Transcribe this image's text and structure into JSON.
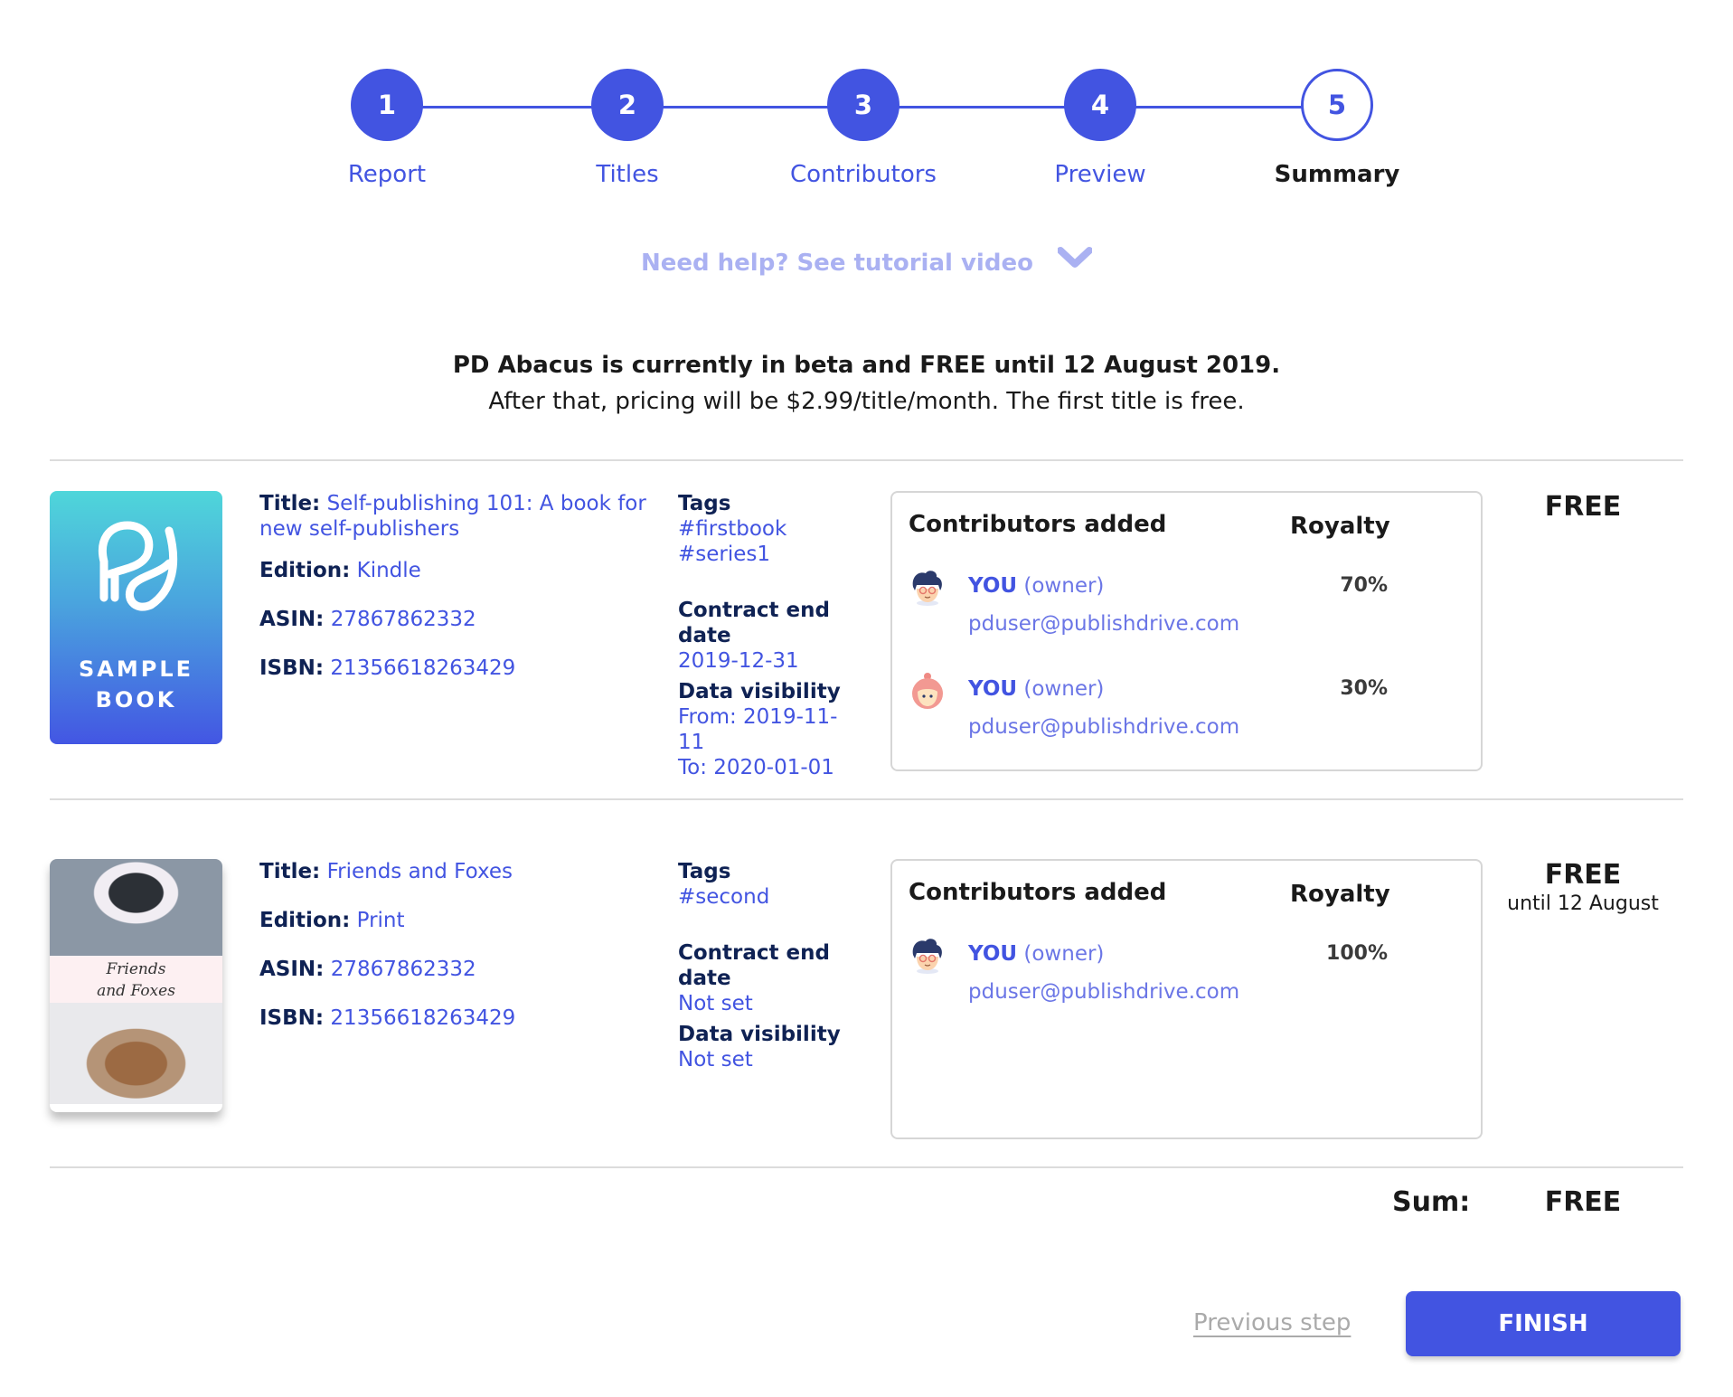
{
  "stepper": {
    "steps": [
      {
        "number": "1",
        "label": "Report",
        "state": "completed"
      },
      {
        "number": "2",
        "label": "Titles",
        "state": "completed"
      },
      {
        "number": "3",
        "label": "Contributors",
        "state": "completed"
      },
      {
        "number": "4",
        "label": "Preview",
        "state": "completed"
      },
      {
        "number": "5",
        "label": "Summary",
        "state": "current"
      }
    ]
  },
  "help": {
    "label": "Need help? See tutorial video",
    "icon": "chevron-down-icon"
  },
  "notice": {
    "line1": "PD Abacus is currently in beta and FREE until 12 August 2019.",
    "line2": "After that, pricing will be $2.99/title/month. The first title is free."
  },
  "labels": {
    "title": "Title:",
    "edition": "Edition:",
    "asin": "ASIN:",
    "isbn": "ISBN:",
    "tags": "Tags",
    "contract_end": "Contract end date",
    "data_visibility": "Data visibility",
    "contributors_added": "Contributors added",
    "royalty": "Royalty"
  },
  "books": [
    {
      "cover_text": "SAMPLE BOOK",
      "title": "Self-publishing 101: A book for new self-publishers",
      "edition": "Kindle",
      "asin": "27867862332",
      "isbn": "21356618263429",
      "tags": [
        "#firstbook",
        "#series1"
      ],
      "contract_end": "2019-12-31",
      "visibility_from": "From: 2019-11-11",
      "visibility_to": "To: 2020-01-01",
      "contributors": [
        {
          "name": "YOU",
          "role": "(owner)",
          "email": "pduser@publishdrive.com",
          "royalty": "70%",
          "avatar": "male-avatar-icon"
        },
        {
          "name": "YOU",
          "role": "(owner)",
          "email": "pduser@publishdrive.com",
          "royalty": "30%",
          "avatar": "female-avatar-icon"
        }
      ],
      "price": "FREE",
      "price_note": ""
    },
    {
      "cover_text": "Friends and Foxes",
      "cover_line1": "Friends",
      "cover_line2": "and Foxes",
      "title": "Friends and Foxes",
      "edition": "Print",
      "asin": "27867862332",
      "isbn": "21356618263429",
      "tags": [
        "#second"
      ],
      "contract_end": "Not set",
      "visibility": "Not set",
      "contributors": [
        {
          "name": "YOU",
          "role": "(owner)",
          "email": "pduser@publishdrive.com",
          "royalty": "100%",
          "avatar": "male-avatar-icon"
        }
      ],
      "price": "FREE",
      "price_note": "until 12 August"
    }
  ],
  "summary": {
    "sum_label": "Sum:",
    "sum_value": "FREE"
  },
  "actions": {
    "previous_label": "Previous step",
    "finish_label": "FINISH"
  },
  "colors": {
    "accent": "#4254e1",
    "help_text": "#aab1f2",
    "label_dark": "#0f2254",
    "muted_link": "#aaaaaa"
  }
}
